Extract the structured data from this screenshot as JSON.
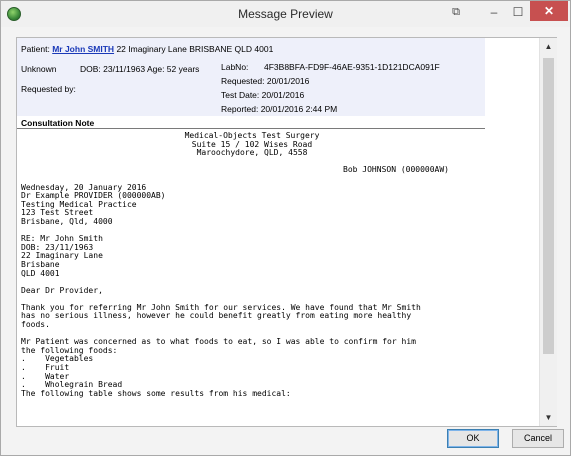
{
  "window": {
    "title": "Message Preview",
    "close_glyph": "✕",
    "minimize_glyph": "–",
    "maximize_glyph": "☐",
    "extra_glyph": "⧉",
    "icon": "app-globe-icon"
  },
  "header": {
    "patient_label": "Patient:",
    "patient_name": "Mr John SMITH",
    "patient_address": "22 Imaginary Lane BRISBANE QLD 4001",
    "sex": "Unknown",
    "dob_age": "DOB: 23/11/1963  Age: 52 years",
    "labno_label": "LabNo:",
    "labno_value": "4F3B8BFA-FD9F-46AE-9351-1D121DCA091F",
    "requested": "Requested: 20/01/2016",
    "requested_by": "Requested by:",
    "test_date": "Test Date:  20/01/2016",
    "reported": "Reported:  20/01/2016 2:44 PM"
  },
  "consultation": {
    "title": "Consultation Note",
    "practice_line1": "Medical-Objects Test Surgery",
    "practice_line2": "Suite 15 / 102 Wises Road",
    "practice_line3": "Maroochydore, QLD, 4558",
    "author": "Bob JOHNSON (000000AW)",
    "body": "Wednesday, 20 January 2016\nDr Example PROVIDER (000000AB)\nTesting Medical Practice\n123 Test Street\nBrisbane, Qld, 4000\n\nRE: Mr John Smith\nDOB: 23/11/1963\n22 Imaginary Lane\nBrisbane\nQLD 4001\n\nDear Dr Provider,\n\nThank you for referring Mr John Smith for our services. We have found that Mr Smith\nhas no serious illness, however he could benefit greatly from eating more healthy\nfoods.\n\nMr Patient was concerned as to what foods to eat, so I was able to confirm for him\nthe following foods:\n.    Vegetables\n.    Fruit\n.    Water\n.    Wholegrain Bread\nThe following table shows some results from his medical:"
  },
  "buttons": {
    "ok": "OK",
    "cancel": "Cancel"
  },
  "scrollbar": {
    "up_glyph": "▲",
    "down_glyph": "▼"
  }
}
